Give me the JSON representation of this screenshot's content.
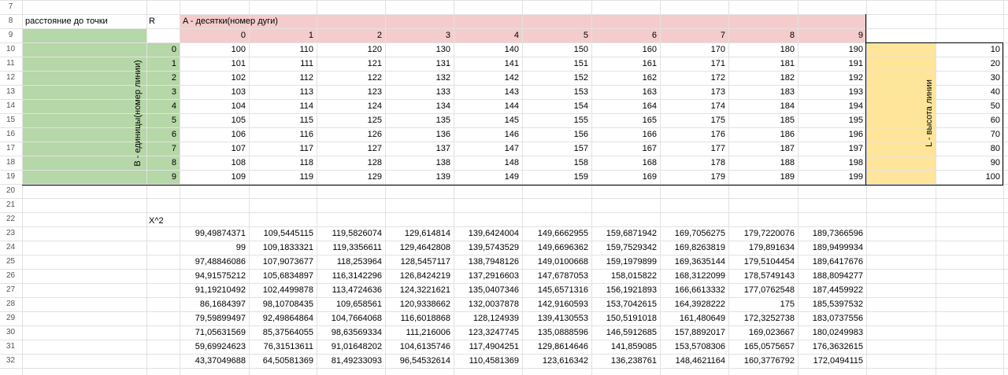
{
  "row_numbers": [
    "7",
    "8",
    "9",
    "10",
    "11",
    "12",
    "13",
    "14",
    "15",
    "16",
    "17",
    "18",
    "19",
    "20",
    "21",
    "22",
    "23",
    "24",
    "25",
    "26",
    "27",
    "28",
    "29",
    "30",
    "31",
    "32"
  ],
  "labels": {
    "distance": "расстояние до точки",
    "r": "R",
    "a_header": "A - десятки(номер дуги)",
    "b_vertical": "B - единицы(номер линии)",
    "l_vertical": "L - высота линии",
    "x2": "X^2"
  },
  "col_indices": [
    "0",
    "1",
    "2",
    "3",
    "4",
    "5",
    "6",
    "7",
    "8",
    "9"
  ],
  "row_indices": [
    "0",
    "1",
    "2",
    "3",
    "4",
    "5",
    "6",
    "7",
    "8",
    "9"
  ],
  "table": [
    [
      "100",
      "110",
      "120",
      "130",
      "140",
      "150",
      "160",
      "170",
      "180",
      "190"
    ],
    [
      "101",
      "111",
      "121",
      "131",
      "141",
      "151",
      "161",
      "171",
      "181",
      "191"
    ],
    [
      "102",
      "112",
      "122",
      "132",
      "142",
      "152",
      "162",
      "172",
      "182",
      "192"
    ],
    [
      "103",
      "113",
      "123",
      "133",
      "143",
      "153",
      "163",
      "173",
      "183",
      "193"
    ],
    [
      "104",
      "114",
      "124",
      "134",
      "144",
      "154",
      "164",
      "174",
      "184",
      "194"
    ],
    [
      "105",
      "115",
      "125",
      "135",
      "145",
      "155",
      "165",
      "175",
      "185",
      "195"
    ],
    [
      "106",
      "116",
      "126",
      "136",
      "146",
      "156",
      "166",
      "176",
      "186",
      "196"
    ],
    [
      "107",
      "117",
      "127",
      "137",
      "147",
      "157",
      "167",
      "177",
      "187",
      "197"
    ],
    [
      "108",
      "118",
      "128",
      "138",
      "148",
      "158",
      "168",
      "178",
      "188",
      "198"
    ],
    [
      "109",
      "119",
      "129",
      "139",
      "149",
      "159",
      "169",
      "179",
      "189",
      "199"
    ]
  ],
  "heights": [
    "10",
    "20",
    "30",
    "40",
    "50",
    "60",
    "70",
    "80",
    "90",
    "100"
  ],
  "x2_table": [
    [
      "99,49874371",
      "109,5445115",
      "119,5826074",
      "129,614814",
      "139,6424004",
      "149,6662955",
      "159,6871942",
      "169,7056275",
      "179,7220076",
      "189,7366596"
    ],
    [
      "99",
      "109,1833321",
      "119,3356611",
      "129,4642808",
      "139,5743529",
      "149,6696362",
      "159,7529342",
      "169,8263819",
      "179,891634",
      "189,9499934"
    ],
    [
      "97,48846086",
      "107,9073677",
      "118,253964",
      "128,5457117",
      "138,7948126",
      "149,0100668",
      "159,1979899",
      "169,3635144",
      "179,5104454",
      "189,6417676"
    ],
    [
      "94,91575212",
      "105,6834897",
      "116,3142296",
      "126,8424219",
      "137,2916603",
      "147,6787053",
      "158,015822",
      "168,3122099",
      "178,5749143",
      "188,8094277"
    ],
    [
      "91,19210492",
      "102,4499878",
      "113,4724636",
      "124,3221621",
      "135,0407346",
      "145,6571316",
      "156,1921893",
      "166,6613332",
      "177,0762548",
      "187,4459922"
    ],
    [
      "86,1684397",
      "98,10708435",
      "109,658561",
      "120,9338662",
      "132,0037878",
      "142,9160593",
      "153,7042615",
      "164,3928222",
      "175",
      "185,5397532"
    ],
    [
      "79,59899497",
      "92,49864864",
      "104,7664068",
      "116,6018868",
      "128,124939",
      "139,4130553",
      "150,5191018",
      "161,480649",
      "172,3252738",
      "183,0737556"
    ],
    [
      "71,05631569",
      "85,37564055",
      "98,63569334",
      "111,216006",
      "123,3247745",
      "135,0888596",
      "146,5912685",
      "157,8892017",
      "169,023667",
      "180,0249983"
    ],
    [
      "59,69924623",
      "76,31513611",
      "91,01648202",
      "104,6135746",
      "117,4904251",
      "129,8614646",
      "141,859085",
      "153,5708306",
      "165,0575657",
      "176,3632615"
    ],
    [
      "43,37049688",
      "64,50581369",
      "81,49233093",
      "96,54532614",
      "110,4581369",
      "123,616342",
      "136,238761",
      "148,4621164",
      "160,3776792",
      "172,0494115"
    ]
  ],
  "colors": {
    "green": "#b6d7a8",
    "pink": "#f4cccc",
    "yellow": "#ffe599",
    "grid": "#e2e2e2",
    "border": "#000000"
  }
}
